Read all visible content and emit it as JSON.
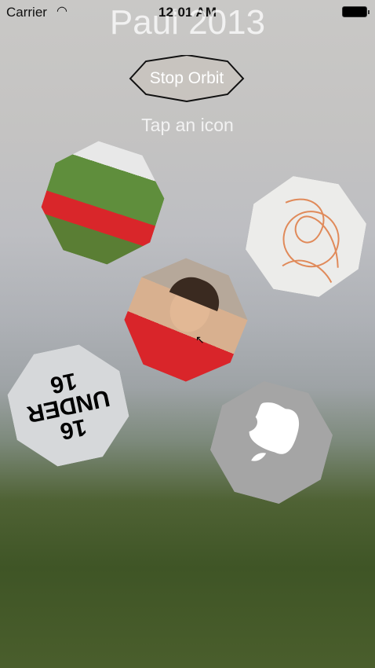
{
  "status_bar": {
    "carrier": "Carrier",
    "time": "12:01 AM"
  },
  "title": "Paul 2013",
  "stop_button": "Stop Orbit",
  "hint": "Tap an icon",
  "icons": [
    {
      "name": "athlete-photo"
    },
    {
      "name": "sketch-drawing"
    },
    {
      "name": "portrait-photo"
    },
    {
      "name": "16-under-16-logo",
      "logo_text": "16 UNDER 16"
    },
    {
      "name": "apple-logo"
    }
  ],
  "colors": {
    "sketch": "#e08a5a",
    "apple_bg": "#a5a5a5"
  }
}
